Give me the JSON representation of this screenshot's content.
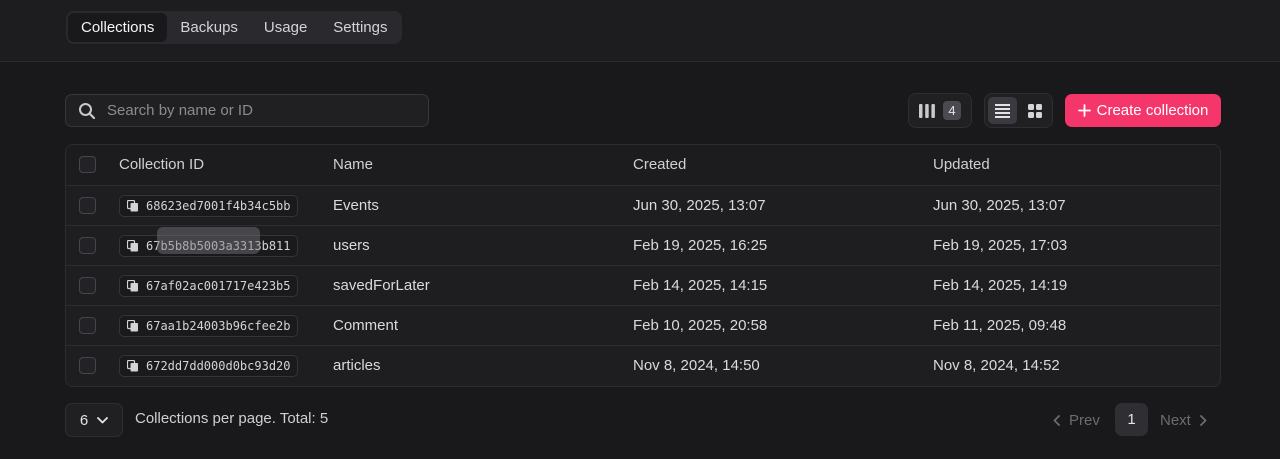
{
  "nav": {
    "tabs": [
      {
        "label": "Collections",
        "active": true
      },
      {
        "label": "Backups",
        "active": false
      },
      {
        "label": "Usage",
        "active": false
      },
      {
        "label": "Settings",
        "active": false
      }
    ]
  },
  "toolbar": {
    "search_placeholder": "Search by name or ID",
    "search_value": "",
    "column_count": "4",
    "create_label": "Create collection",
    "accent_color": "#f4366b"
  },
  "table": {
    "headers": {
      "id": "Collection ID",
      "name": "Name",
      "created": "Created",
      "updated": "Updated"
    },
    "rows": [
      {
        "id": "68623ed7001f4b34c5bb",
        "name": "Events",
        "created": "Jun 30, 2025, 13:07",
        "updated": "Jun 30, 2025, 13:07"
      },
      {
        "id": "67b5b8b5003a3313b811",
        "name": "users",
        "created": "Feb 19, 2025, 16:25",
        "updated": "Feb 19, 2025, 17:03"
      },
      {
        "id": "67af02ac001717e423b5",
        "name": "savedForLater",
        "created": "Feb 14, 2025, 14:15",
        "updated": "Feb 14, 2025, 14:19"
      },
      {
        "id": "67aa1b24003b96cfee2b",
        "name": "Comment",
        "created": "Feb 10, 2025, 20:58",
        "updated": "Feb 11, 2025, 09:48"
      },
      {
        "id": "672dd7dd000d0bc93d20",
        "name": "articles",
        "created": "Nov 8, 2024, 14:50",
        "updated": "Nov 8, 2024, 14:52"
      }
    ]
  },
  "footer": {
    "per_page_value": "6",
    "per_page_label": "Collections per page. Total: 5",
    "prev_label": "Prev",
    "next_label": "Next",
    "current_page": "1"
  }
}
